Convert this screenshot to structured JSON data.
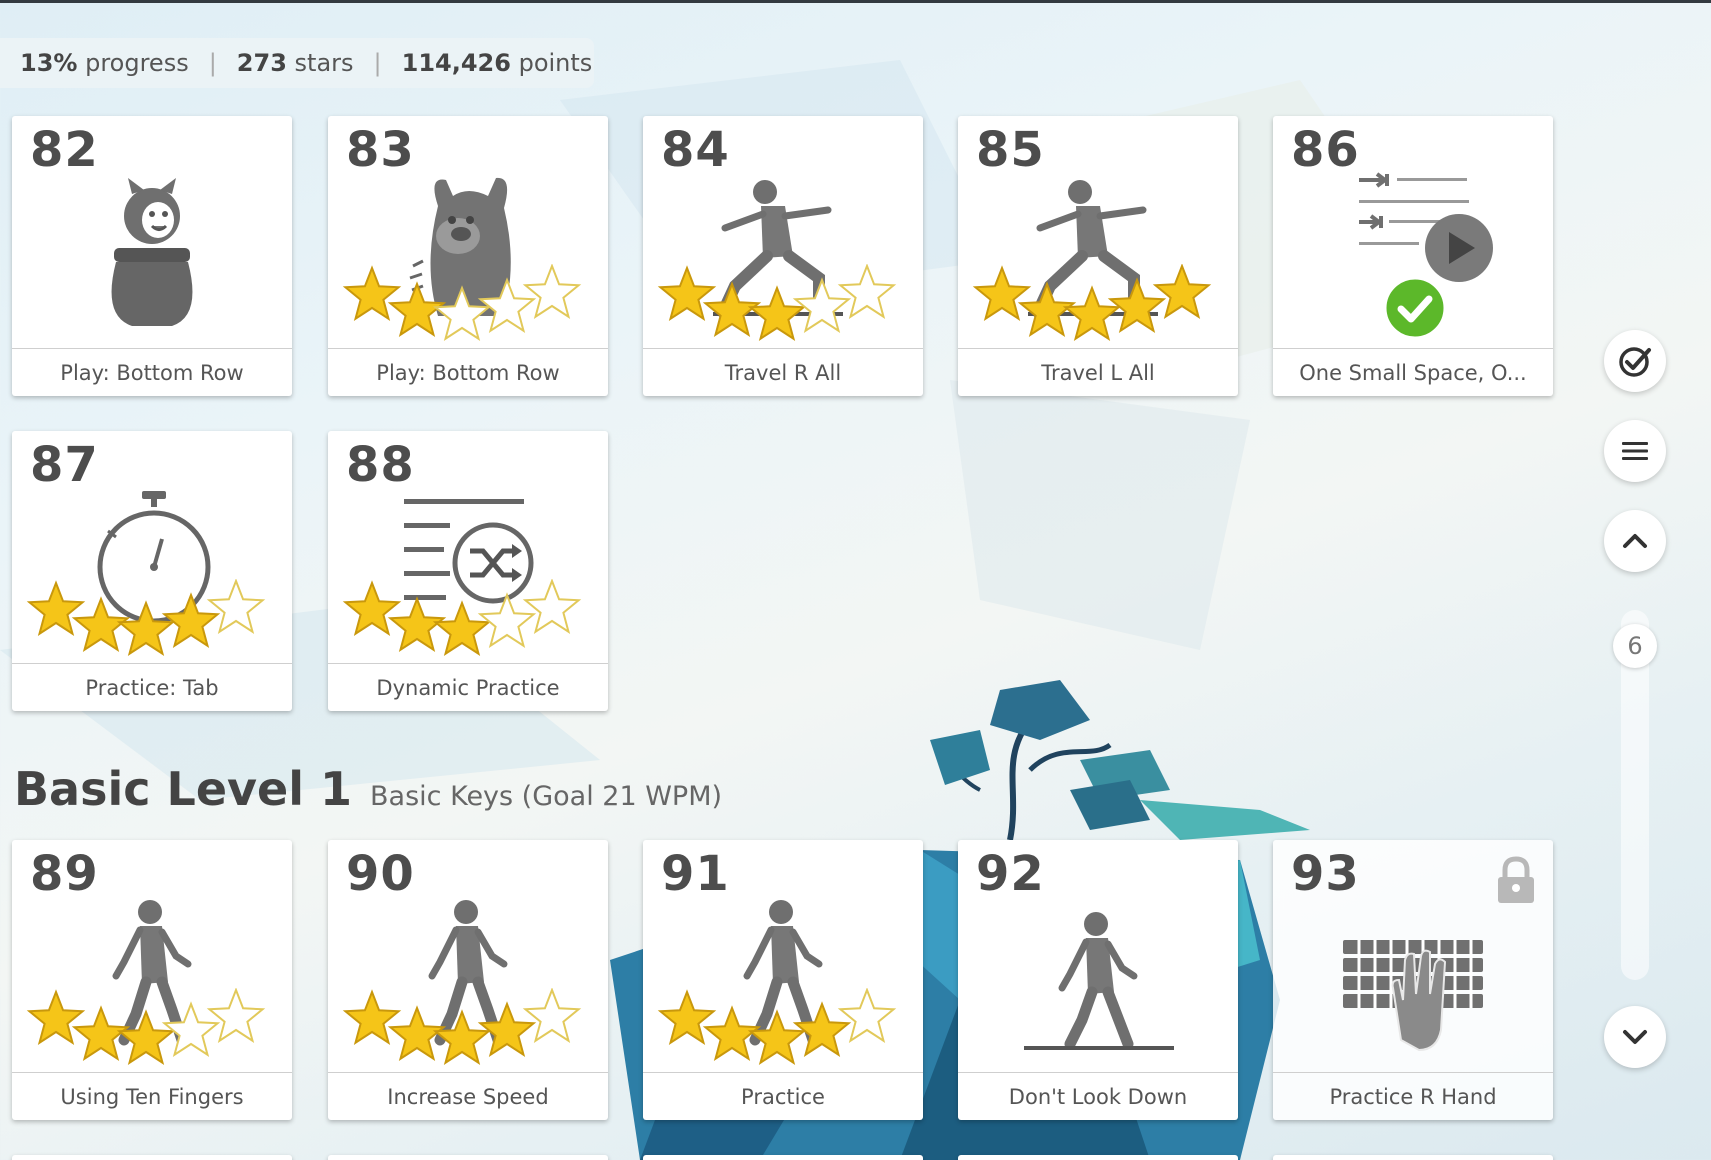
{
  "stats": {
    "progress_value": "13%",
    "progress_label": "progress",
    "stars_value": "273",
    "stars_label": "stars",
    "points_value": "114,426",
    "points_label": "points",
    "separator": "|"
  },
  "section": {
    "title": "Basic Level 1",
    "subtitle": "Basic Keys (Goal 21 WPM)"
  },
  "lessons": [
    {
      "number": "82",
      "label": "Play: Bottom Row",
      "stars": 0,
      "icon": "jar-creature-icon"
    },
    {
      "number": "83",
      "label": "Play: Bottom Row",
      "stars": 2,
      "icon": "monster-creature-icon"
    },
    {
      "number": "84",
      "label": "Travel R All",
      "stars": 3,
      "icon": "lunge-pose-icon"
    },
    {
      "number": "85",
      "label": "Travel L All",
      "stars": 5,
      "icon": "lunge-pose-icon"
    },
    {
      "number": "86",
      "label": "One Small Space, O...",
      "stars": 0,
      "icon": "video-lesson-icon",
      "completed": true
    },
    {
      "number": "87",
      "label": "Practice: Tab",
      "stars": 4,
      "icon": "stopwatch-icon"
    },
    {
      "number": "88",
      "label": "Dynamic Practice",
      "stars": 3,
      "icon": "shuffle-list-icon"
    },
    {
      "number": "89",
      "label": "Using Ten Fingers",
      "stars": 3,
      "icon": "walking-person-icon"
    },
    {
      "number": "90",
      "label": "Increase Speed",
      "stars": 4,
      "icon": "walking-person-icon"
    },
    {
      "number": "91",
      "label": "Practice",
      "stars": 4,
      "icon": "walking-person-icon"
    },
    {
      "number": "92",
      "label": "Don't Look Down",
      "stars": 0,
      "icon": "walking-person-icon"
    },
    {
      "number": "93",
      "label": "Practice R Hand",
      "stars": 0,
      "icon": "keyboard-hand-icon",
      "locked": true
    }
  ],
  "sidebar": {
    "scroll_indicator": "6",
    "buttons": [
      "check-circle-icon",
      "menu-icon",
      "chevron-up-icon",
      "chevron-down-icon"
    ]
  },
  "colors": {
    "star_fill": "#f5c518",
    "check_green": "#5cb82a",
    "icon_gray": "#6f6f6f"
  }
}
